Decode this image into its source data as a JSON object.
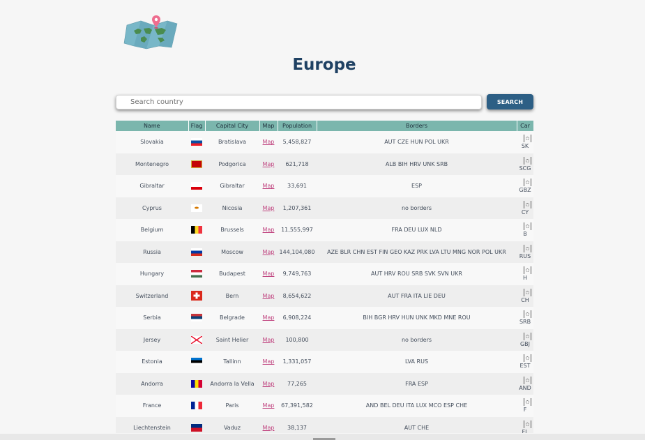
{
  "page": {
    "title": "Europe"
  },
  "search": {
    "placeholder": "Search country",
    "button_label": "SEARCH"
  },
  "table": {
    "headers": {
      "name": "Name",
      "flag": "Flag",
      "capital": "Capital City",
      "map": "Map",
      "population": "Population",
      "borders": "Borders",
      "car": "Car"
    },
    "rows": [
      {
        "name": "Slovakia",
        "flag_colors": [
          "#ffffff",
          "#0b4ea2",
          "#ee1c25"
        ],
        "capital": "Bratislava",
        "map": "Map",
        "population": "5,458,827",
        "borders": "AUT CZE HUN POL UKR",
        "car": "SK"
      },
      {
        "name": "Montenegro",
        "flag_colors": [
          "#d3ae3b",
          "#c40308"
        ],
        "capital": "Podgorica",
        "map": "Map",
        "population": "621,718",
        "borders": "ALB BIH HRV UNK SRB",
        "car": "SCG"
      },
      {
        "name": "Gibraltar",
        "flag_colors": [
          "#ffffff",
          "#da000c"
        ],
        "capital": "Gibraltar",
        "map": "Map",
        "population": "33,691",
        "borders": "ESP",
        "car": "GBZ"
      },
      {
        "name": "Cyprus",
        "flag_colors": [
          "#ffffff",
          "#d57800"
        ],
        "capital": "Nicosia",
        "map": "Map",
        "population": "1,207,361",
        "borders": "no borders",
        "car": "CY"
      },
      {
        "name": "Belgium",
        "flag_colors": [
          "#000000",
          "#fdda24",
          "#ef3340"
        ],
        "capital": "Brussels",
        "map": "Map",
        "population": "11,555,997",
        "borders": "FRA DEU LUX NLD",
        "car": "B"
      },
      {
        "name": "Russia",
        "flag_colors": [
          "#ffffff",
          "#0039a6",
          "#d52b1e"
        ],
        "capital": "Moscow",
        "map": "Map",
        "population": "144,104,080",
        "borders": "AZE BLR CHN EST FIN GEO KAZ PRK LVA LTU MNG NOR POL UKR",
        "car": "RUS"
      },
      {
        "name": "Hungary",
        "flag_colors": [
          "#cd2a3e",
          "#ffffff",
          "#436f4d"
        ],
        "capital": "Budapest",
        "map": "Map",
        "population": "9,749,763",
        "borders": "AUT HRV ROU SRB SVK SVN UKR",
        "car": "H"
      },
      {
        "name": "Switzerland",
        "flag_colors": [
          "#da291c",
          "#ffffff"
        ],
        "capital": "Bern",
        "map": "Map",
        "population": "8,654,622",
        "borders": "AUT FRA ITA LIE DEU",
        "car": "CH"
      },
      {
        "name": "Serbia",
        "flag_colors": [
          "#c6363c",
          "#0c4076",
          "#ffffff"
        ],
        "capital": "Belgrade",
        "map": "Map",
        "population": "6,908,224",
        "borders": "BIH BGR HRV HUN UNK MKD MNE ROU",
        "car": "SRB"
      },
      {
        "name": "Jersey",
        "flag_colors": [
          "#ffffff",
          "#e8112d"
        ],
        "capital": "Saint Helier",
        "map": "Map",
        "population": "100,800",
        "borders": "no borders",
        "car": "GBJ"
      },
      {
        "name": "Estonia",
        "flag_colors": [
          "#0072ce",
          "#000000",
          "#ffffff"
        ],
        "capital": "Tallinn",
        "map": "Map",
        "population": "1,331,057",
        "borders": "LVA RUS",
        "car": "EST"
      },
      {
        "name": "Andorra",
        "flag_colors": [
          "#10069f",
          "#fedd00",
          "#d50032"
        ],
        "capital": "Andorra la Vella",
        "map": "Map",
        "population": "77,265",
        "borders": "FRA ESP",
        "car": "AND"
      },
      {
        "name": "France",
        "flag_colors": [
          "#002395",
          "#ffffff",
          "#ed2939"
        ],
        "capital": "Paris",
        "map": "Map",
        "population": "67,391,582",
        "borders": "AND BEL DEU ITA LUX MCO ESP CHE",
        "car": "F"
      },
      {
        "name": "Liechtenstein",
        "flag_colors": [
          "#002b7f",
          "#ce1126"
        ],
        "capital": "Vaduz",
        "map": "Map",
        "population": "38,137",
        "borders": "AUT CHE",
        "car": "FL"
      }
    ]
  },
  "colors": {
    "header_bg": "#7bb6ad",
    "button_bg": "#2d5f85",
    "title": "#1f4163",
    "link": "#c0437f"
  }
}
